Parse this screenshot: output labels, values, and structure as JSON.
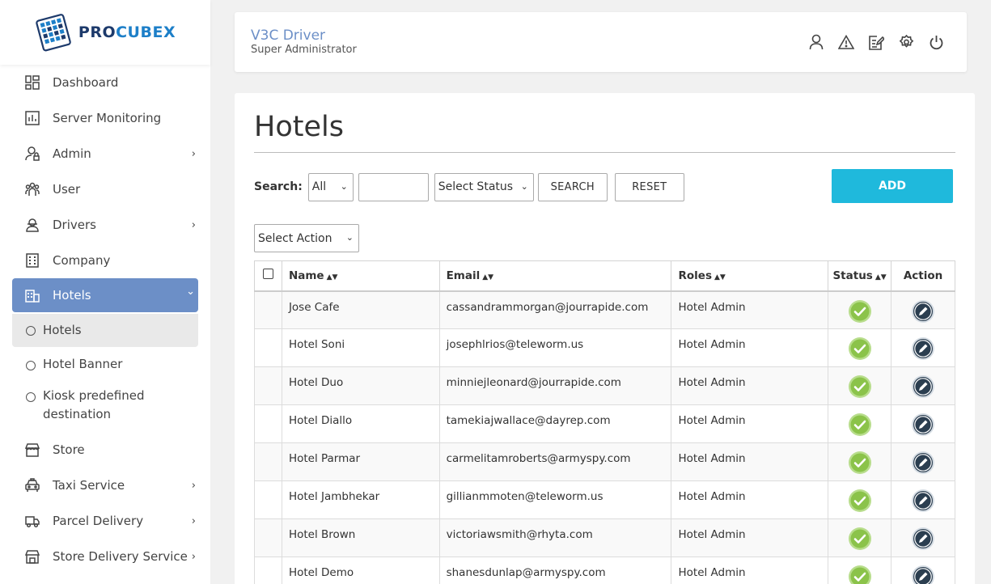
{
  "logo": {
    "pro": "PRO",
    "cubex": "CUBEX"
  },
  "sidebar": {
    "items": [
      {
        "label": "Dashboard",
        "icon": "dashboard-icon"
      },
      {
        "label": "Server Monitoring",
        "icon": "server-monitoring-icon"
      },
      {
        "label": "Admin",
        "icon": "admin-icon",
        "chevron": "›"
      },
      {
        "label": "User",
        "icon": "users-icon"
      },
      {
        "label": "Drivers",
        "icon": "driver-icon",
        "chevron": "›"
      },
      {
        "label": "Company",
        "icon": "building-icon"
      },
      {
        "label": "Hotels",
        "icon": "hotel-icon",
        "chevron": "⌄"
      },
      {
        "label": "Store",
        "icon": "store-icon"
      },
      {
        "label": "Taxi Service",
        "icon": "taxi-icon",
        "chevron": "›"
      },
      {
        "label": "Parcel Delivery",
        "icon": "truck-icon",
        "chevron": "›"
      },
      {
        "label": "Store Delivery Service",
        "icon": "store-delivery-icon",
        "chevron": "›"
      }
    ],
    "hotel_sub": [
      {
        "label": "Hotels"
      },
      {
        "label": "Hotel Banner"
      },
      {
        "label": "Kiosk predefined destination"
      }
    ]
  },
  "header": {
    "title": "V3C Driver",
    "subtitle": "Super Administrator",
    "icons": [
      "user-icon",
      "alert-icon",
      "edit-icon",
      "settings-icon",
      "power-icon"
    ]
  },
  "page": {
    "title": "Hotels",
    "search_label": "Search:",
    "search_field_select": "All",
    "search_input_value": "",
    "status_select": "Select Status",
    "search_button": "SEARCH",
    "reset_button": "RESET",
    "add_button": "ADD",
    "action_select": "Select Action"
  },
  "table": {
    "headers": {
      "name": "Name",
      "email": "Email",
      "roles": "Roles",
      "status": "Status",
      "action": "Action"
    },
    "rows": [
      {
        "name": "Jose Cafe",
        "email": "cassandrammorgan@jourrapide.com",
        "role": "Hotel Admin"
      },
      {
        "name": "Hotel Soni",
        "email": "josephlrios@teleworm.us",
        "role": "Hotel Admin"
      },
      {
        "name": "Hotel Duo",
        "email": "minniejleonard@jourrapide.com",
        "role": "Hotel Admin"
      },
      {
        "name": "Hotel Diallo",
        "email": "tamekiajwallace@dayrep.com",
        "role": "Hotel Admin"
      },
      {
        "name": "Hotel Parmar",
        "email": "carmelitamroberts@armyspy.com",
        "role": "Hotel Admin"
      },
      {
        "name": "Hotel Jambhekar",
        "email": "gillianmmoten@teleworm.us",
        "role": "Hotel Admin"
      },
      {
        "name": "Hotel Brown",
        "email": "victoriawsmith@rhyta.com",
        "role": "Hotel Admin"
      },
      {
        "name": "Hotel Demo",
        "email": "shanesdunlap@armyspy.com",
        "role": "Hotel Admin"
      }
    ]
  },
  "colors": {
    "accent": "#6c8fc7",
    "add": "#1fb9dc",
    "status_ok": "#8bc34a",
    "edit": "#2b3e50"
  }
}
